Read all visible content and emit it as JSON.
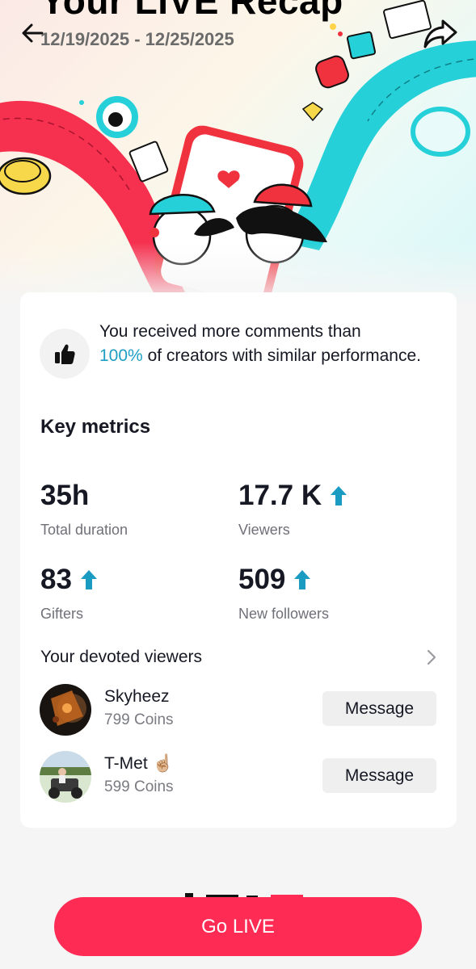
{
  "header": {
    "title": "Your LIVE Recap",
    "date_range": "12/19/2025 - 12/25/2025"
  },
  "icons": {
    "back": "arrow-left-icon",
    "share": "share-arrow-icon",
    "insight": "thumbs-up-icon",
    "chevron": "chevron-right-icon",
    "trend": "up-arrow-icon"
  },
  "colors": {
    "accent_red": "#fe2c55",
    "accent_cyan": "#25d0d8",
    "highlight_blue": "#1f9ec4",
    "trend_arrow": "#1a9bc2"
  },
  "insight": {
    "text_before": "You received more comments than",
    "highlight": "100%",
    "text_after": "of creators with similar performance."
  },
  "key_metrics": {
    "title": "Key metrics",
    "items": [
      {
        "value": "35h",
        "label": "Total duration",
        "trend_up": false
      },
      {
        "value": "17.7 K",
        "label": "Viewers",
        "trend_up": true
      },
      {
        "value": "83",
        "label": "Gifters",
        "trend_up": true
      },
      {
        "value": "509",
        "label": "New followers",
        "trend_up": true
      }
    ]
  },
  "devoted_viewers": {
    "title": "Your devoted viewers",
    "items": [
      {
        "name": "Skyheez",
        "coins": "799 Coins",
        "button": "Message"
      },
      {
        "name": "T-Met ☝🏼",
        "coins": "599 Coins",
        "button": "Message"
      }
    ]
  },
  "cta": {
    "label": "Go LIVE"
  }
}
